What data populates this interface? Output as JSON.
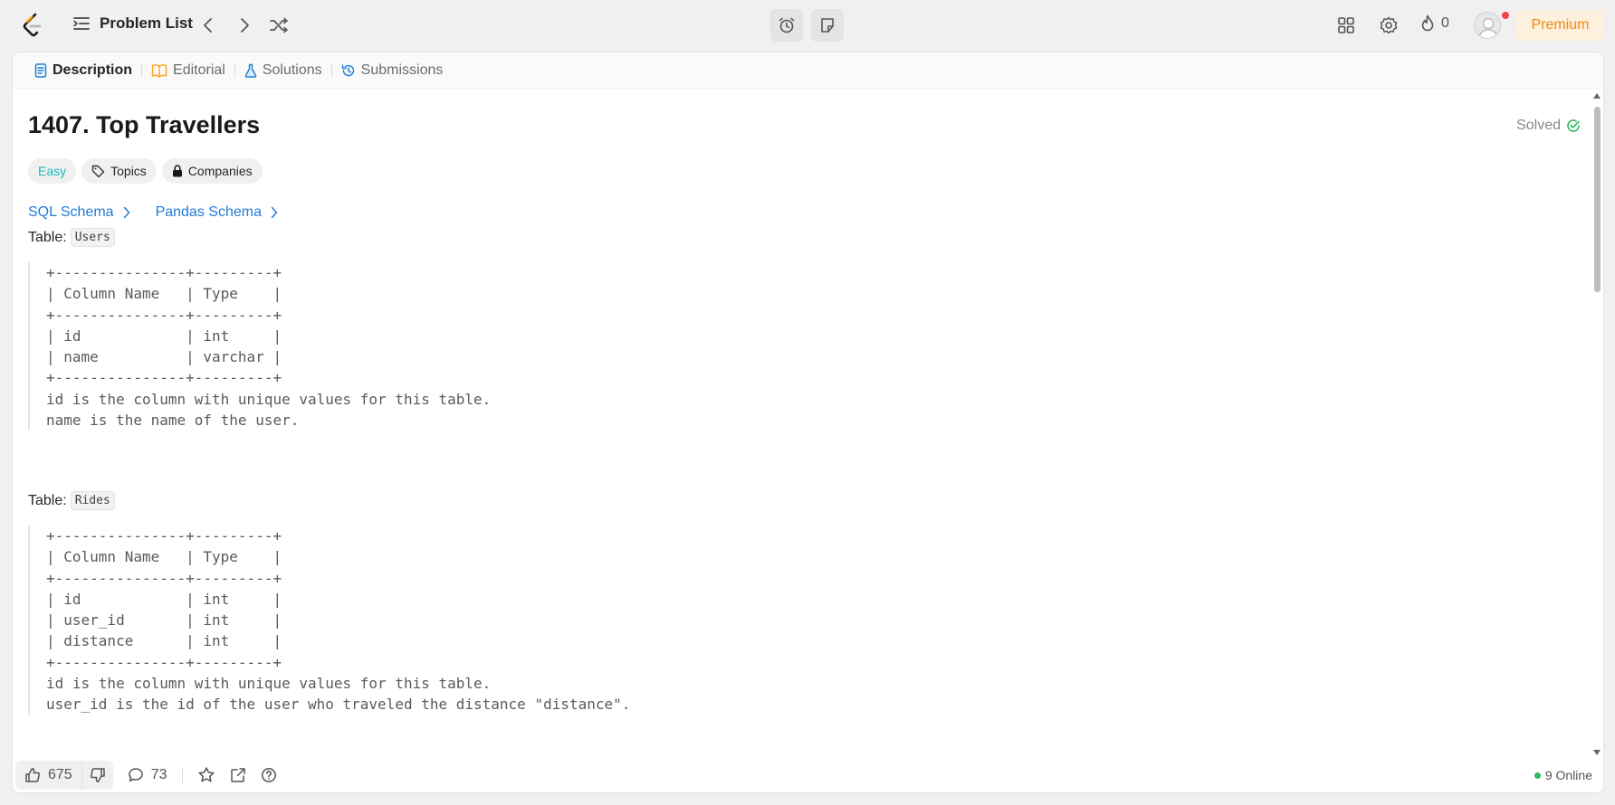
{
  "topbar": {
    "problem_list_label": "Problem List",
    "streak_count": "0",
    "premium_label": "Premium"
  },
  "tabs": [
    {
      "label": "Description"
    },
    {
      "label": "Editorial"
    },
    {
      "label": "Solutions"
    },
    {
      "label": "Submissions"
    }
  ],
  "problem": {
    "title": "1407. Top Travellers",
    "status": "Solved",
    "tags": {
      "difficulty": "Easy",
      "topics": "Topics",
      "companies": "Companies"
    },
    "schemas": {
      "sql": "SQL Schema",
      "pandas": "Pandas Schema"
    },
    "table_word": "Table:",
    "tables": [
      {
        "name": "Users",
        "block": "+---------------+---------+\n| Column Name   | Type    |\n+---------------+---------+\n| id            | int     |\n| name          | varchar |\n+---------------+---------+\nid is the column with unique values for this table.\nname is the name of the user."
      },
      {
        "name": "Rides",
        "block": "+---------------+---------+\n| Column Name   | Type    |\n+---------------+---------+\n| id            | int     |\n| user_id       | int     |\n| distance      | int     |\n+---------------+---------+\nid is the column with unique values for this table.\nuser_id is the id of the user who traveled the distance \"distance\"."
      }
    ]
  },
  "bottombar": {
    "likes": "675",
    "comments": "73",
    "online": "9 Online"
  },
  "colors": {
    "accent_link": "#1f7cd8",
    "easy": "#1cb8b8",
    "solved": "#2cbb5d",
    "premium": "#f08a12",
    "premium_bg": "#fdf0dc",
    "notification": "#ef4743"
  },
  "icons": [
    "leetcode-logo",
    "list-icon",
    "chevron-left-icon",
    "chevron-right-icon",
    "shuffle-icon",
    "alarm-icon",
    "note-icon",
    "layout-icon",
    "gear-icon",
    "fire-icon",
    "avatar-icon",
    "description-icon",
    "book-icon",
    "flask-icon",
    "history-icon",
    "check-circle-icon",
    "tag-icon",
    "lock-icon",
    "thumbs-up-icon",
    "thumbs-down-icon",
    "comment-icon",
    "star-icon",
    "share-icon",
    "help-icon"
  ]
}
